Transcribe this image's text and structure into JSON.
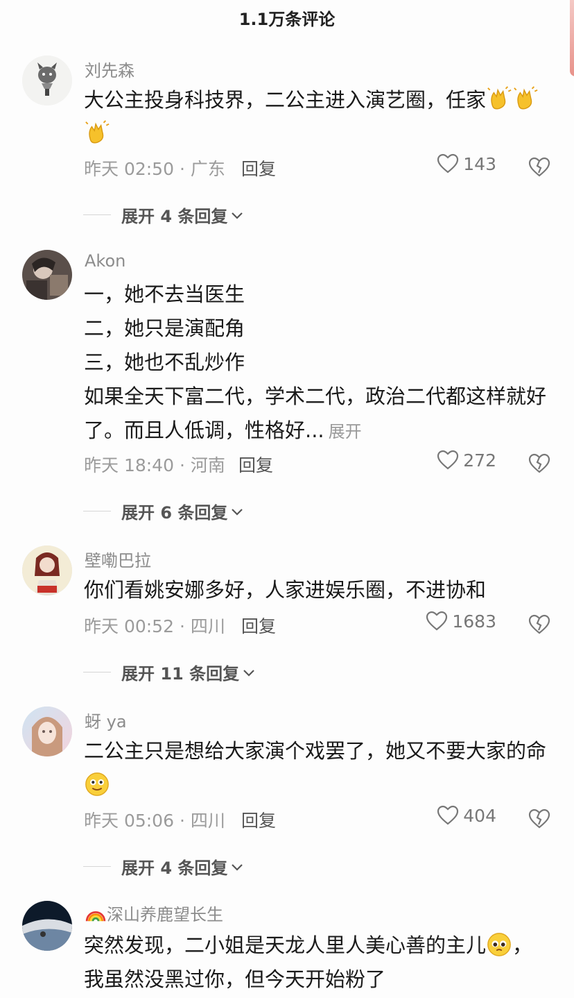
{
  "header": {
    "title": "1.1万条评论"
  },
  "comments": [
    {
      "username": "刘先森",
      "lines": [
        "大公主投身科技界，二公主进入演艺圈，任家"
      ],
      "time_location": "昨天 02:50 · 广东",
      "reply_label": "回复",
      "likes": "143",
      "expand_replies": "展开 4 条回复"
    },
    {
      "username": "Akon",
      "lines": [
        "一，她不去当医生",
        "二，她只是演配角",
        "三，她也不乱炒作",
        "如果全天下富二代，学术二代，政治二代都这样就好",
        "了。而且人低调，性格好..."
      ],
      "expand_text": "展开",
      "time_location": "昨天 18:40 · 河南",
      "reply_label": "回复",
      "likes": "272",
      "expand_replies": "展开 6 条回复"
    },
    {
      "username": "壁嘞巴拉",
      "lines": [
        "你们看姚安娜多好，人家进娱乐圈，不进协和"
      ],
      "time_location": "昨天 00:52 · 四川",
      "reply_label": "回复",
      "likes": "1683",
      "expand_replies": "展开 11 条回复"
    },
    {
      "username": "蚜 ya",
      "lines": [
        "二公主只是想给大家演个戏罢了，她又不要大家的命"
      ],
      "time_location": "昨天 05:06 · 四川",
      "reply_label": "回复",
      "likes": "404",
      "expand_replies": "展开 4 条回复"
    },
    {
      "username": "深山养鹿望长生",
      "lines": [
        "突然发现，二小姐是天龙人里人美心善的主儿",
        "我虽然没黑过你，但今天开始粉了"
      ]
    }
  ],
  "icons": {
    "like": "heart-outline-icon",
    "dislike": "broken-heart-icon",
    "expand": "chevron-down-icon",
    "emoji_clap": "clapping-hands-emoji",
    "emoji_smile": "smiling-face-emoji",
    "emoji_plead": "pleading-face-emoji",
    "emoji_rainbow": "rainbow-emoji"
  },
  "colors": {
    "text": "#1a1a1a",
    "muted": "#9b9b9b",
    "reply": "#555555"
  }
}
